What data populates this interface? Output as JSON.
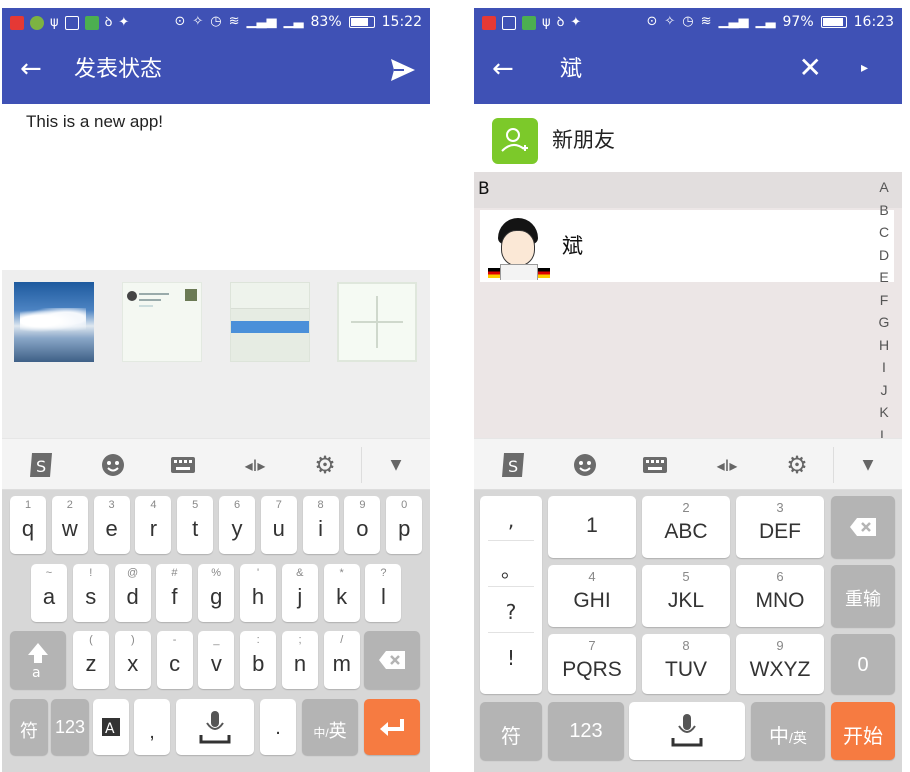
{
  "left": {
    "status": {
      "battery": "83%",
      "time": "15:22",
      "battery_fill": 0.83
    },
    "appbar": {
      "title": "发表状态"
    },
    "post_text": "This is a new app!",
    "photos": [
      "sky-photo",
      "screenshot-contacts",
      "screenshot-form",
      "add-photo"
    ],
    "keyboard": {
      "row1": [
        {
          "k": "q",
          "n": "1"
        },
        {
          "k": "w",
          "n": "2"
        },
        {
          "k": "e",
          "n": "3"
        },
        {
          "k": "r",
          "n": "4"
        },
        {
          "k": "t",
          "n": "5"
        },
        {
          "k": "y",
          "n": "6"
        },
        {
          "k": "u",
          "n": "7"
        },
        {
          "k": "i",
          "n": "8"
        },
        {
          "k": "o",
          "n": "9"
        },
        {
          "k": "p",
          "n": "0"
        }
      ],
      "row2": [
        {
          "k": "a",
          "n": "~"
        },
        {
          "k": "s",
          "n": "!"
        },
        {
          "k": "d",
          "n": "@"
        },
        {
          "k": "f",
          "n": "#"
        },
        {
          "k": "g",
          "n": "%"
        },
        {
          "k": "h",
          "n": "'"
        },
        {
          "k": "j",
          "n": "&"
        },
        {
          "k": "k",
          "n": "*"
        },
        {
          "k": "l",
          "n": "?"
        }
      ],
      "row3": [
        {
          "k": "z",
          "n": "("
        },
        {
          "k": "x",
          "n": ")"
        },
        {
          "k": "c",
          "n": "-"
        },
        {
          "k": "v",
          "n": "_"
        },
        {
          "k": "b",
          "n": ":"
        },
        {
          "k": "n",
          "n": ";"
        },
        {
          "k": "m",
          "n": "/"
        }
      ],
      "fu": "符",
      "num": "123",
      "comma": ",",
      "period": ".",
      "lang_small": "中/",
      "lang_big": "英"
    }
  },
  "right": {
    "status": {
      "battery": "97%",
      "time": "16:23",
      "battery_fill": 0.97
    },
    "appbar": {
      "title": "斌"
    },
    "new_friend": "新朋友",
    "section": "B",
    "contact": "斌",
    "alpha": [
      "A",
      "B",
      "C",
      "D",
      "E",
      "F",
      "G",
      "H",
      "I",
      "J",
      "K",
      "L"
    ],
    "keyboard": {
      "symbols": [
        ",",
        "。",
        "?",
        "!"
      ],
      "keys": [
        {
          "main": "1",
          "sub": ""
        },
        {
          "main": "ABC",
          "sub": "2"
        },
        {
          "main": "DEF",
          "sub": "3"
        },
        {
          "main": "GHI",
          "sub": "4"
        },
        {
          "main": "JKL",
          "sub": "5"
        },
        {
          "main": "MNO",
          "sub": "6"
        },
        {
          "main": "PQRS",
          "sub": "7"
        },
        {
          "main": "TUV",
          "sub": "8"
        },
        {
          "main": "WXYZ",
          "sub": "9"
        }
      ],
      "reenter": "重输",
      "zero": "0",
      "fu": "符",
      "num": "123",
      "lang_big": "中",
      "lang_small": "/英",
      "start": "开始"
    }
  },
  "colors": {
    "primary": "#3f51b5",
    "accent_orange": "#f67b41",
    "new_friend_green": "#7cc92a",
    "keyboard_bg": "#d7d7d7"
  }
}
